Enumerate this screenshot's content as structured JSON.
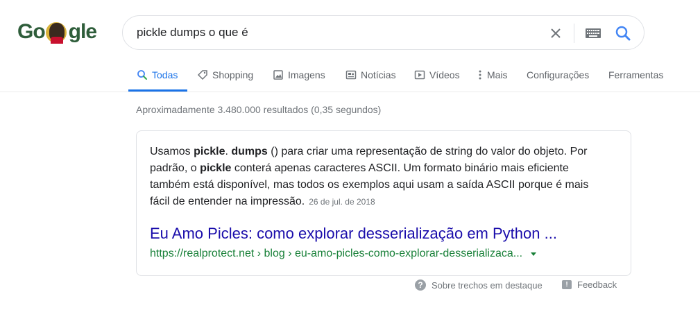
{
  "logo": {
    "part1": "Go",
    "part2": "gle"
  },
  "search": {
    "query": "pickle dumps o que é",
    "clear_icon": "close-icon",
    "keyboard_icon": "keyboard-icon",
    "search_icon": "search-icon"
  },
  "tabs": [
    {
      "label": "Todas",
      "icon": "search-icon",
      "active": true
    },
    {
      "label": "Shopping",
      "icon": "tag-icon"
    },
    {
      "label": "Imagens",
      "icon": "image-icon"
    },
    {
      "label": "Notícias",
      "icon": "news-icon"
    },
    {
      "label": "Vídeos",
      "icon": "video-icon"
    },
    {
      "label": "Mais",
      "icon": "more-vert-icon"
    },
    {
      "label": "Configurações"
    },
    {
      "label": "Ferramentas"
    }
  ],
  "stats": "Aproximadamente 3.480.000 resultados (0,35 segundos)",
  "featured_snippet": {
    "text_segments": [
      {
        "t": "Usamos ",
        "bold": false
      },
      {
        "t": "pickle",
        "bold": true
      },
      {
        "t": ". ",
        "bold": false
      },
      {
        "t": "dumps",
        "bold": true
      },
      {
        "t": " () para criar uma representação de string do valor do objeto. Por padrão, o ",
        "bold": false
      },
      {
        "t": "pickle",
        "bold": true
      },
      {
        "t": " conterá apenas caracteres ASCII. Um formato binário mais eficiente também está disponível, mas todos os exemplos aqui usam a saída ASCII porque é mais fácil de entender na impressão.",
        "bold": false
      }
    ],
    "date": "26 de jul. de 2018",
    "title": "Eu Amo Picles: como explorar desserialização em Python ...",
    "url": "https://realprotect.net › blog › eu-amo-picles-como-explorar-desserializaca..."
  },
  "footer": {
    "about_label": "Sobre trechos em destaque",
    "feedback_label": "Feedback"
  },
  "colors": {
    "accent": "#1a73e8",
    "link": "#1a0dab",
    "url_green": "#188038",
    "muted": "#70757a"
  }
}
